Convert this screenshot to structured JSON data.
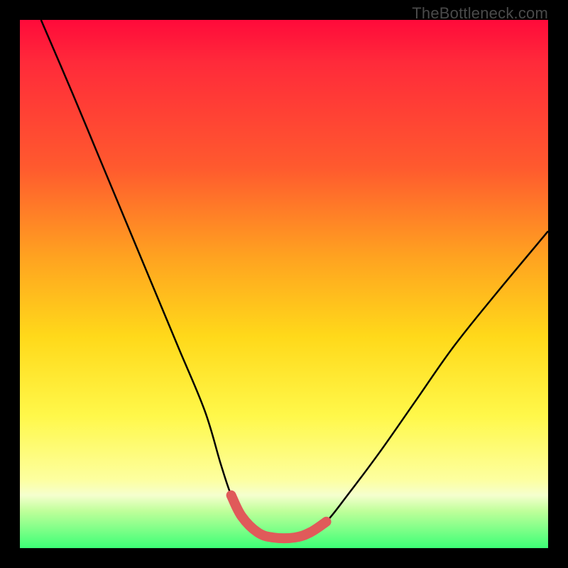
{
  "attribution": "TheBottleneck.com",
  "colors": {
    "frame": "#000000",
    "gradient_top": "#ff0a3a",
    "gradient_bottom": "#3cff76",
    "curve": "#000000",
    "highlight": "#e05a5a"
  },
  "chart_data": {
    "type": "line",
    "title": "",
    "xlabel": "",
    "ylabel": "",
    "xlim": [
      0,
      100
    ],
    "ylim": [
      0,
      100
    ],
    "grid": false,
    "legend": false,
    "series": [
      {
        "name": "curve",
        "x": [
          4,
          10,
          15,
          20,
          25,
          30,
          35,
          38,
          40,
          42,
          45,
          48,
          52,
          55,
          58,
          62,
          68,
          75,
          82,
          90,
          100
        ],
        "y": [
          100,
          86,
          74,
          62,
          50,
          38,
          26,
          16,
          10,
          6,
          3,
          2,
          2,
          3,
          5,
          10,
          18,
          28,
          38,
          48,
          60
        ]
      },
      {
        "name": "highlight-segment",
        "x": [
          40,
          42,
          45,
          48,
          52,
          55,
          58
        ],
        "y": [
          10,
          6,
          3,
          2,
          2,
          3,
          5
        ]
      }
    ],
    "annotations": []
  }
}
